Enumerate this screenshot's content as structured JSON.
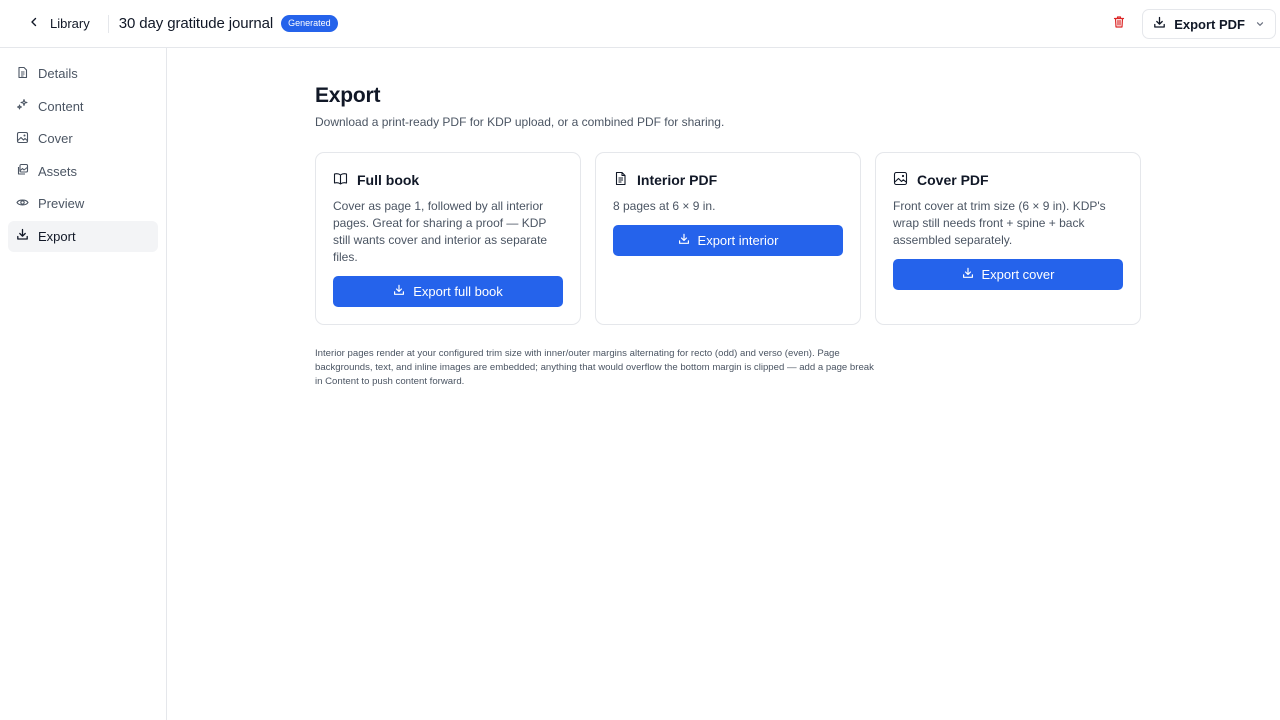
{
  "header": {
    "back_label": "Library",
    "doc_title": "30 day gratitude journal",
    "status_badge": "Generated",
    "export_dropdown_label": "Export PDF"
  },
  "sidebar": {
    "items": [
      {
        "label": "Details",
        "icon": "document-icon"
      },
      {
        "label": "Content",
        "icon": "sparkles-icon"
      },
      {
        "label": "Cover",
        "icon": "cover-image-icon"
      },
      {
        "label": "Assets",
        "icon": "assets-icon"
      },
      {
        "label": "Preview",
        "icon": "eye-icon"
      },
      {
        "label": "Export",
        "icon": "download-icon",
        "active": true
      }
    ]
  },
  "main": {
    "title": "Export",
    "subtitle": "Download a print-ready PDF for KDP upload, or a combined PDF for sharing.",
    "cards": [
      {
        "title": "Full book",
        "icon": "book-icon",
        "description": "Cover as page 1, followed by all interior pages. Great for sharing a proof — KDP still wants cover and interior as separate files.",
        "button_label": "Export full book"
      },
      {
        "title": "Interior PDF",
        "icon": "file-text-icon",
        "description": "8 pages at 6 × 9 in.",
        "button_label": "Export interior"
      },
      {
        "title": "Cover PDF",
        "icon": "image-icon",
        "description": "Front cover at trim size (6 × 9 in). KDP's wrap still needs front + spine + back assembled separately.",
        "button_label": "Export cover"
      }
    ],
    "note": "Interior pages render at your configured trim size with inner/outer margins alternating for recto (odd) and verso (even). Page backgrounds, text, and inline images are embedded; anything that would overflow the bottom margin is clipped — add a page break in Content to push content forward."
  },
  "colors": {
    "accent": "#2563eb",
    "danger": "#dc2626",
    "border": "#e5e7eb",
    "active_nav_bg": "#f3f4f6"
  }
}
